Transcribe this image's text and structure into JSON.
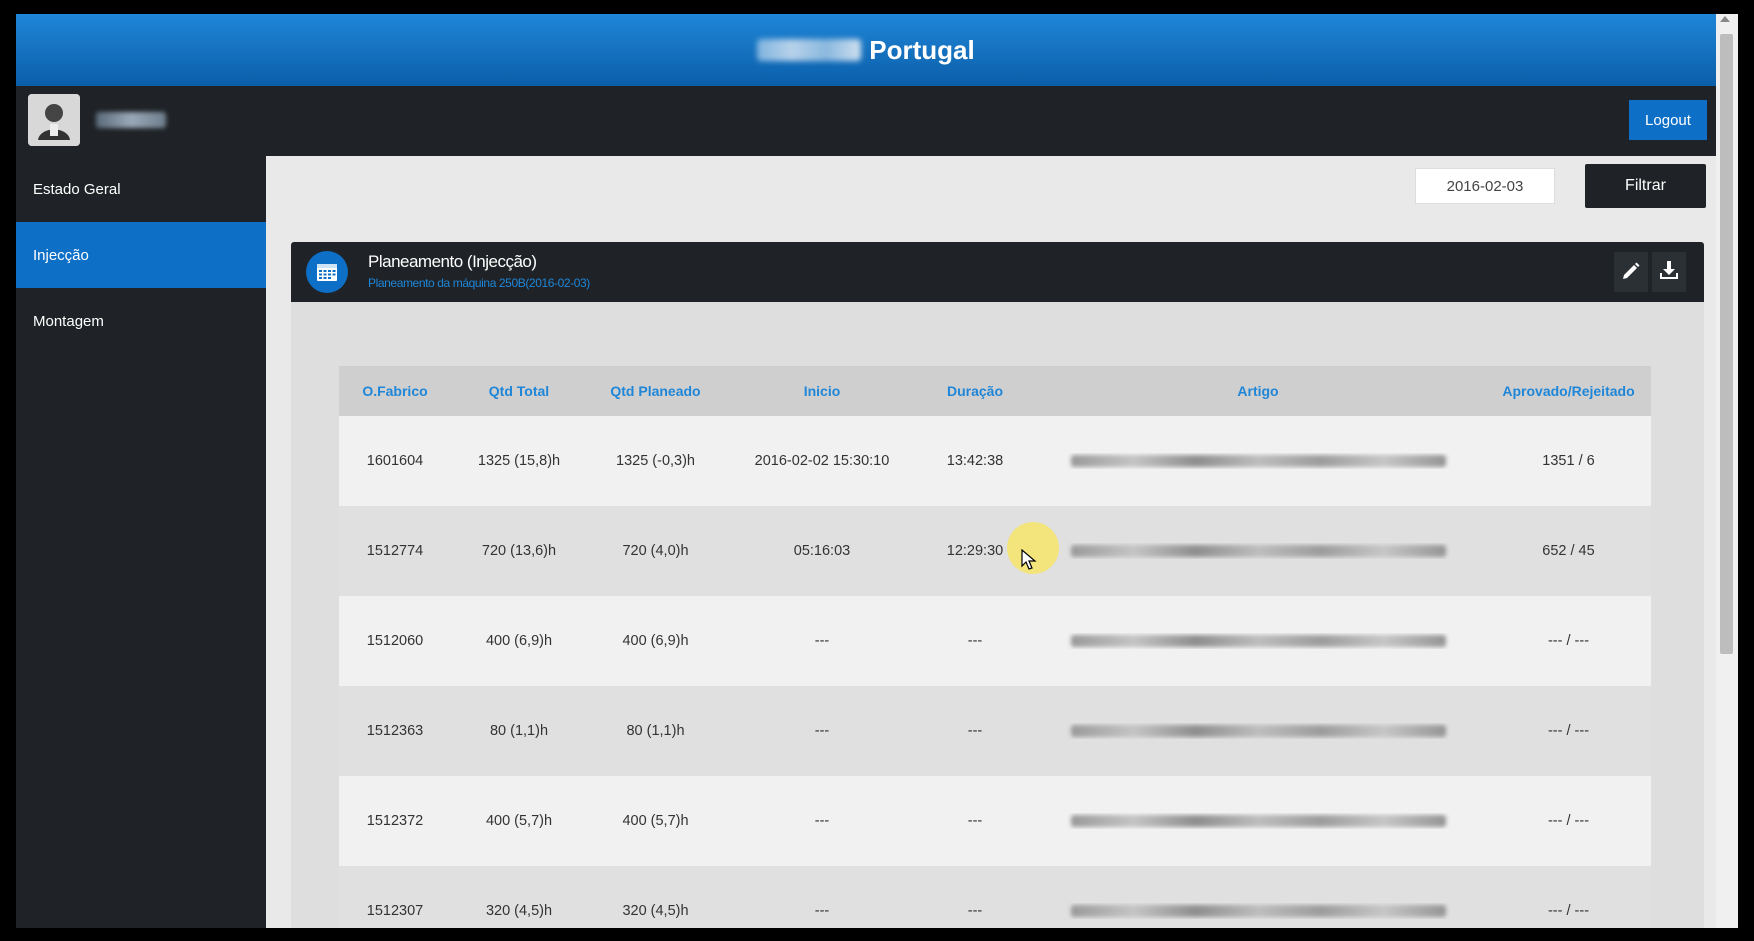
{
  "brand": {
    "title": "Portugal"
  },
  "user": {
    "logout_label": "Logout"
  },
  "sidebar": {
    "items": [
      {
        "label": "Estado Geral",
        "active": false
      },
      {
        "label": "Injecção",
        "active": true
      },
      {
        "label": "Montagem",
        "active": false
      }
    ]
  },
  "filter": {
    "date_value": "2016-02-03",
    "button_label": "Filtrar"
  },
  "panel": {
    "title": "Planeamento (Injecção)",
    "subtitle": "Planeamento da máquina 250B(2016-02-03)",
    "icons": [
      "pencil-icon",
      "download-icon",
      "calendar-icon"
    ]
  },
  "table": {
    "headers": [
      "O.Fabrico",
      "Qtd Total",
      "Qtd Planeado",
      "Inicio",
      "Duração",
      "Artigo",
      "Aprovado/Rejeitado"
    ],
    "rows": [
      {
        "ofabrico": "1601604",
        "qtd_total": "1325 (15,8)h",
        "qtd_planeado": "1325 (-0,3)h",
        "inicio": "2016-02-02 15:30:10",
        "duracao": "13:42:38",
        "aprovado": "1351 / 6"
      },
      {
        "ofabrico": "1512774",
        "qtd_total": "720 (13,6)h",
        "qtd_planeado": "720 (4,0)h",
        "inicio": "05:16:03",
        "duracao": "12:29:30",
        "aprovado": "652 / 45"
      },
      {
        "ofabrico": "1512060",
        "qtd_total": "400 (6,9)h",
        "qtd_planeado": "400 (6,9)h",
        "inicio": "---",
        "duracao": "---",
        "aprovado": "--- / ---"
      },
      {
        "ofabrico": "1512363",
        "qtd_total": "80 (1,1)h",
        "qtd_planeado": "80 (1,1)h",
        "inicio": "---",
        "duracao": "---",
        "aprovado": "--- / ---"
      },
      {
        "ofabrico": "1512372",
        "qtd_total": "400 (5,7)h",
        "qtd_planeado": "400 (5,7)h",
        "inicio": "---",
        "duracao": "---",
        "aprovado": "--- / ---"
      },
      {
        "ofabrico": "1512307",
        "qtd_total": "320 (4,5)h",
        "qtd_planeado": "320 (4,5)h",
        "inicio": "---",
        "duracao": "---",
        "aprovado": "--- / ---"
      }
    ]
  },
  "colors": {
    "accent": "#0d6fc6",
    "header_blue": "#1f86d8",
    "dark": "#1f2327"
  }
}
